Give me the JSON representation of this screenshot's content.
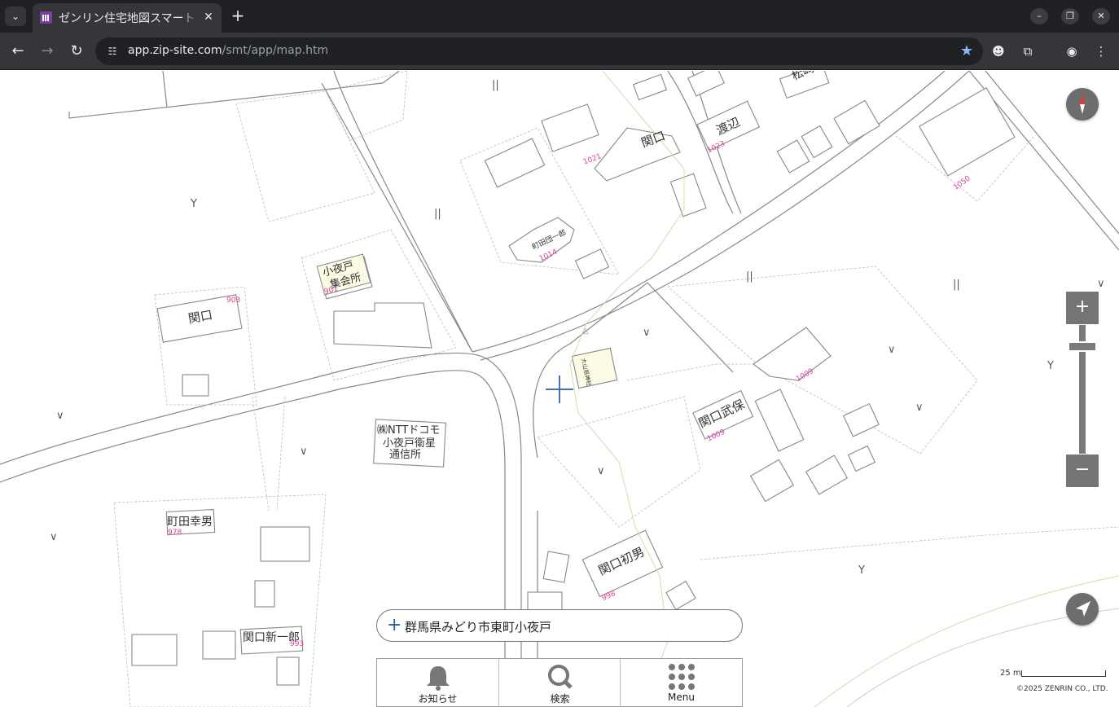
{
  "browser": {
    "tab_title": "ゼンリン住宅地図スマート",
    "url_host": "app.zip-site.com",
    "url_path": "/smt/app/map.htm"
  },
  "map": {
    "labels": {
      "matsuzaki": "松崎",
      "sekiguchi_top": "関口",
      "watanabe": "渡辺",
      "machida_ichiro": "町田団一郎",
      "koyado_hall_1": "小夜戸",
      "koyado_hall_2": "集会所",
      "sekiguchi_left": "関口",
      "ntt_1": "㈱NTTドコモ",
      "ntt_2": "小夜戸衛星",
      "ntt_3": "通信所",
      "sekiguchi_takeyasu": "関口武保",
      "machida_yukio": "町田幸男",
      "sekiguchi_hatsuo": "関口初男",
      "sekiguchi_shinichiro": "関口新一郎",
      "shrine_small": "大山祇神社"
    },
    "house_numbers": {
      "n1021": "1021",
      "n1014": "1014",
      "n1023": "1023",
      "n1050": "1050",
      "n903": "903",
      "n901": "901",
      "n1009a": "1009",
      "n1009b": "1009",
      "n978": "978",
      "n998": "998",
      "n993": "993"
    },
    "address": "群馬県みどり市東町小夜戸",
    "scale_label": "25 m",
    "copyright": "©2025 ZENRIN CO., LTD."
  },
  "controls": {
    "zoom_in": "+",
    "zoom_out": "−",
    "zoom_level": 0.14
  },
  "bottom_menu": {
    "news": "お知らせ",
    "search": "検索",
    "menu": "Menu"
  }
}
